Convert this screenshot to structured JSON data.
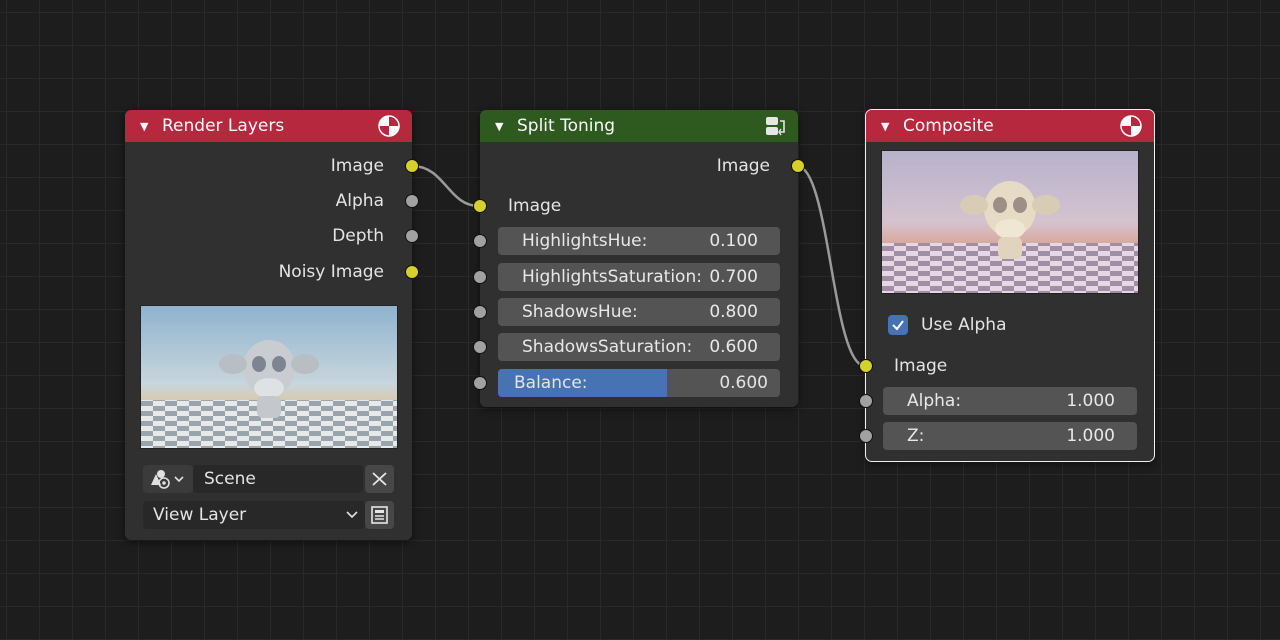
{
  "render_layers": {
    "title": "Render Layers",
    "outputs": [
      "Image",
      "Alpha",
      "Depth",
      "Noisy Image"
    ],
    "scene_value": "Scene",
    "view_layer_value": "View Layer"
  },
  "split_toning": {
    "title": "Split Toning",
    "output": "Image",
    "input": "Image",
    "fields": [
      {
        "label": "HighlightsHue:",
        "value": "0.100"
      },
      {
        "label": "HighlightsSaturation:",
        "value": "0.700"
      },
      {
        "label": "ShadowsHue:",
        "value": "0.800"
      },
      {
        "label": "ShadowsSaturation:",
        "value": "0.600"
      }
    ],
    "balance": {
      "label": "Balance:",
      "value": "0.600",
      "fraction": 0.6
    }
  },
  "composite": {
    "title": "Composite",
    "use_alpha_label": "Use Alpha",
    "use_alpha_checked": true,
    "input": "Image",
    "fields": [
      {
        "label": "Alpha:",
        "value": "1.000"
      },
      {
        "label": "Z:",
        "value": "1.000"
      }
    ]
  },
  "colors": {
    "background": "#1d1d1d",
    "node_body": "#303030",
    "header_red": "#b5283e",
    "header_green": "#2f5a1f",
    "socket_yellow": "#d6d12a",
    "socket_gray": "#a1a1a1",
    "accent_blue": "#4772b3"
  },
  "icons": [
    "collapse-arrow-icon",
    "render-icon",
    "group-node-icon",
    "scene-data-icon",
    "clear-icon",
    "dropdown-chevron-icon",
    "new-layer-icon",
    "checkmark-icon"
  ]
}
